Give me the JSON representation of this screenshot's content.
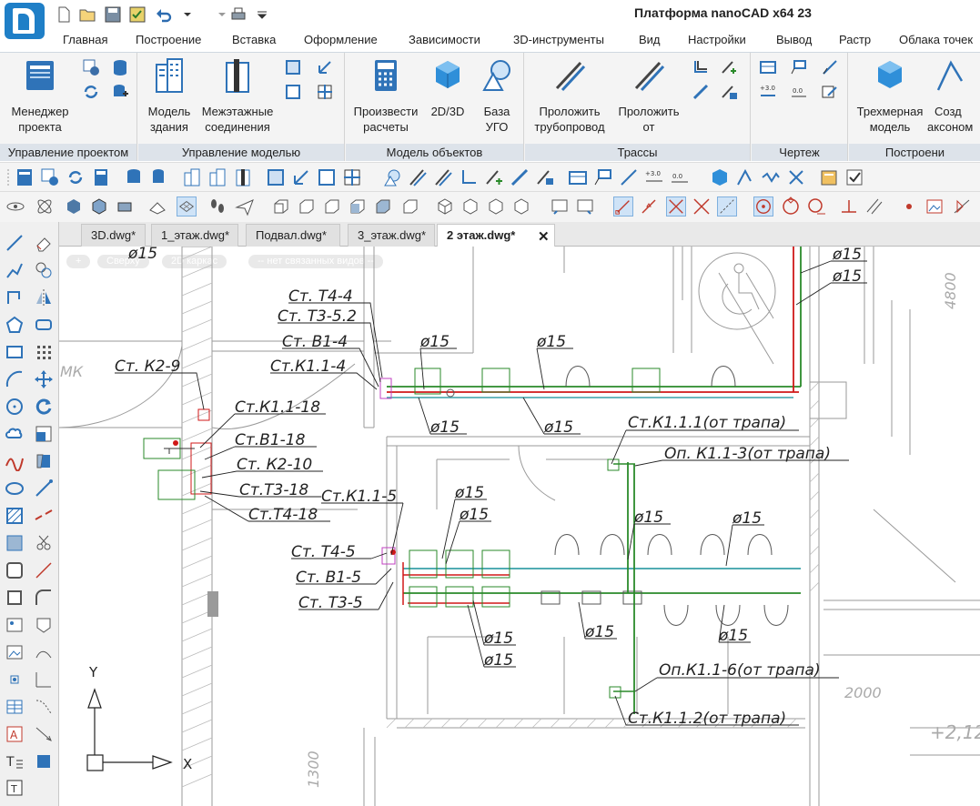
{
  "app": {
    "title": "Платформа nanoCAD x64 23"
  },
  "menu": [
    "Главная",
    "Построение",
    "Вставка",
    "Оформление",
    "Зависимости",
    "3D-инструменты",
    "Вид",
    "Настройки",
    "Вывод",
    "Растр",
    "Облака точек"
  ],
  "ribbon": {
    "panels": [
      {
        "title": "Управление проектом",
        "buttons": [
          {
            "l1": "Менеджер",
            "l2": "проекта"
          }
        ]
      },
      {
        "title": "Управление моделью",
        "buttons": [
          {
            "l1": "Модель",
            "l2": "здания"
          },
          {
            "l1": "Межэтажные",
            "l2": "соединения"
          }
        ]
      },
      {
        "title": "Модель объектов",
        "buttons": [
          {
            "l1": "Произвести",
            "l2": "расчеты"
          },
          {
            "l1": "2D/3D",
            "l2": ""
          },
          {
            "l1": "База",
            "l2": "УГО"
          }
        ]
      },
      {
        "title": "Трассы",
        "buttons": [
          {
            "l1": "Проложить",
            "l2": "трубопровод"
          },
          {
            "l1": "Проложить",
            "l2": "от"
          }
        ]
      },
      {
        "title": "Чертеж",
        "buttons": []
      },
      {
        "title": "Построени",
        "buttons": [
          {
            "l1": "Трехмерная",
            "l2": "модель"
          },
          {
            "l1": "Созд",
            "l2": "аксоном"
          }
        ]
      }
    ]
  },
  "doc_tabs": [
    "3D.dwg*",
    "1_этаж.dwg*",
    "Подвал.dwg*",
    "3_этаж.dwg*",
    "2 этаж.dwg*"
  ],
  "view_controls": [
    "+",
    "Сверху",
    "2D каркас",
    "-- нет связанных видов --"
  ],
  "drawing": {
    "labels": {
      "phi": "ø15",
      "st_t4_4": "Ст. Т4-4",
      "st_t3_52": "Ст. Т3-5.2",
      "st_v1_4": "Ст. В1-4",
      "st_k11_4": "Ст.К1.1-4",
      "st_k2_9": "Ст. К2-9",
      "st_k11_18": "Ст.К1.1-18",
      "st_v1_18": "Ст.В1-18",
      "st_k2_10": "Ст. К2-10",
      "st_t3_18": "Ст.Т3-18",
      "st_k11_5": "Ст.К1.1-5",
      "st_t4_18": "Ст.Т4-18",
      "st_t4_5": "Ст. Т4-5",
      "st_v1_5": "Ст. В1-5",
      "st_t3_5": "Ст. Т3-5",
      "st_k111": "Ст.К1.1.1(от трапа)",
      "op_k11_3": "Оп. К1.1-3(от трапа)",
      "op_k11_6": "Оп.К1.1-6(от трапа)",
      "st_k112": "Ст.К1.1.2(от трапа)",
      "dim_4800": "4800",
      "dim_2000": "2000",
      "dim_1300": "1300",
      "level": "+2,12",
      "mk": "МК",
      "axis_y": "Y",
      "axis_x": "X"
    }
  }
}
